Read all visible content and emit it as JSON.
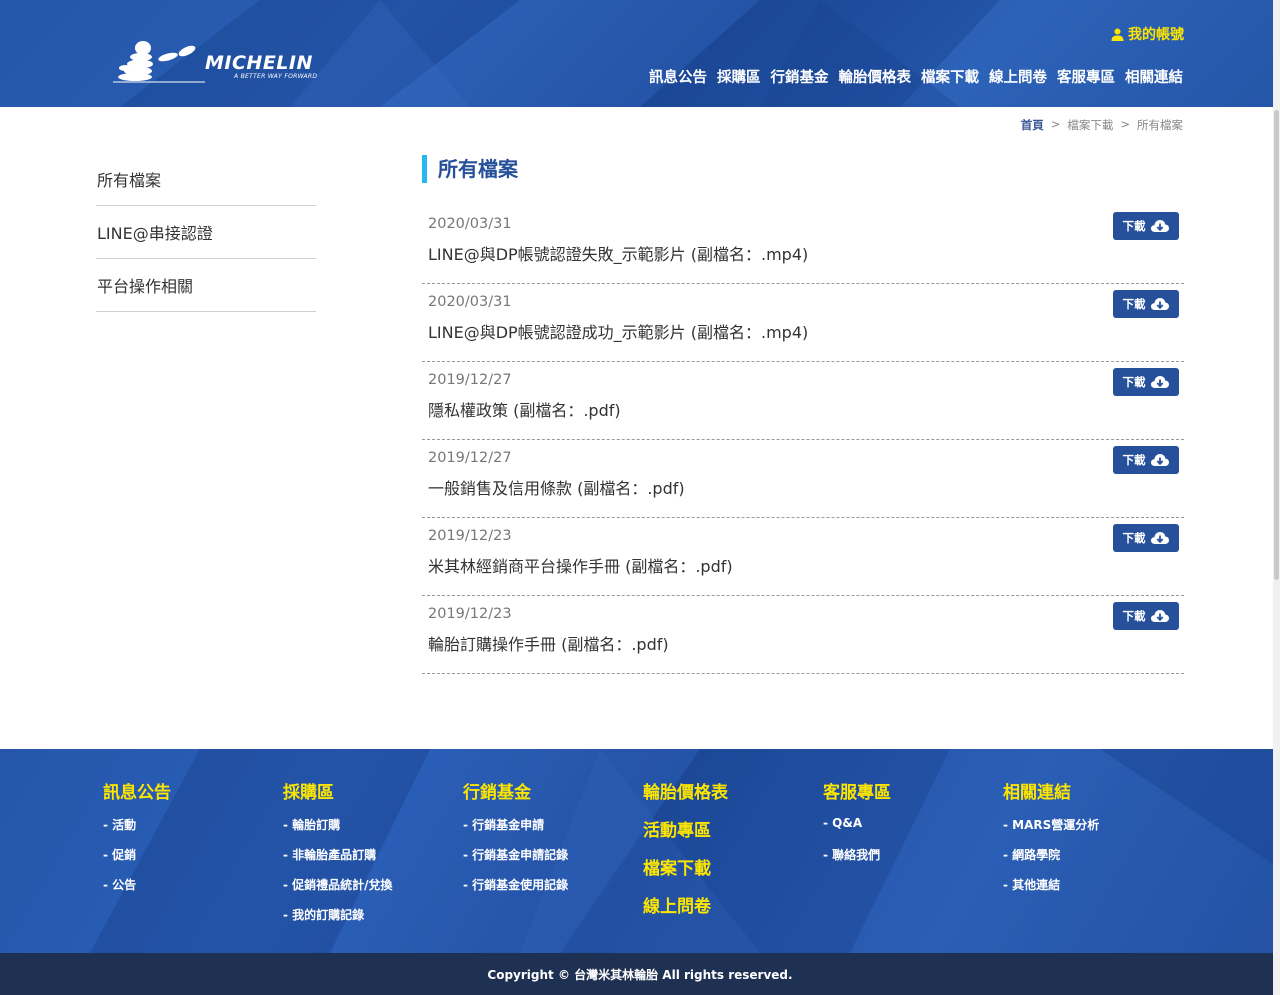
{
  "header": {
    "logo": {
      "word": "MICHELIN",
      "tagline": "A BETTER WAY FORWARD"
    },
    "account_label": "我的帳號",
    "nav": [
      "訊息公告",
      "採購區",
      "行銷基金",
      "輪胎價格表",
      "檔案下載",
      "線上問卷",
      "客服專區",
      "相關連結"
    ]
  },
  "breadcrumb": {
    "home": "首頁",
    "sep": ">",
    "section": "檔案下載",
    "current": "所有檔案"
  },
  "sidebar": {
    "items": [
      "所有檔案",
      "LINE@串接認證",
      "平台操作相關"
    ]
  },
  "main": {
    "title": "所有檔案",
    "download_label": "下載",
    "files": [
      {
        "date": "2020/03/31",
        "name": "LINE@與DP帳號認證失敗_示範影片 (副檔名：.mp4)"
      },
      {
        "date": "2020/03/31",
        "name": "LINE@與DP帳號認證成功_示範影片 (副檔名：.mp4)"
      },
      {
        "date": "2019/12/27",
        "name": "隱私權政策 (副檔名：.pdf)"
      },
      {
        "date": "2019/12/27",
        "name": "一般銷售及信用條款 (副檔名：.pdf)"
      },
      {
        "date": "2019/12/23",
        "name": "米其林經銷商平台操作手冊 (副檔名：.pdf)"
      },
      {
        "date": "2019/12/23",
        "name": "輪胎訂購操作手冊 (副檔名：.pdf)"
      }
    ]
  },
  "footer": {
    "col1": {
      "title": "訊息公告",
      "items": [
        "活動",
        "促銷",
        "公告"
      ]
    },
    "col2": {
      "title": "採購區",
      "items": [
        "輪胎訂購",
        "非輪胎產品訂購",
        "促銷禮品統計/兌換",
        "我的訂購記錄"
      ]
    },
    "col3": {
      "title": "行銷基金",
      "items": [
        "行銷基金申請",
        "行銷基金申請記錄",
        "行銷基金使用記錄"
      ]
    },
    "col4": {
      "items": [
        "輪胎價格表",
        "活動專區",
        "檔案下載",
        "線上問卷"
      ]
    },
    "col5": {
      "title": "客服專區",
      "items": [
        "Q&A",
        "聯絡我們"
      ]
    },
    "col6": {
      "title": "相關連結",
      "items": [
        "MARS營運分析",
        "網路學院",
        "其他連結"
      ]
    },
    "item_prefix": "- ",
    "copyright": "Copyright © 台灣米其林輪胎 All rights reserved."
  },
  "colors": {
    "brand_blue": "#27509b",
    "accent_yellow": "#fce500",
    "title_bar": "#27b7f1"
  },
  "icons": {
    "account": "user-icon",
    "download": "cloud-download-icon",
    "logo": "bibendum-logo"
  }
}
